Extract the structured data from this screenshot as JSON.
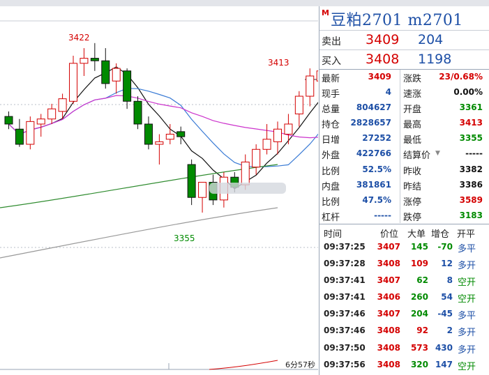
{
  "header": {
    "marker": "M",
    "title": "豆粕2701  m2701"
  },
  "quote": {
    "sell": {
      "label": "卖出",
      "price": "3409",
      "volume": "204"
    },
    "buy": {
      "label": "买入",
      "price": "3408",
      "volume": "1198"
    }
  },
  "stats": [
    {
      "l1": "最新",
      "v1": "3409",
      "c1": "red",
      "l2": "涨跌",
      "v2": "23/0.68%",
      "c2": "red"
    },
    {
      "l1": "现手",
      "v1": "4",
      "c1": "blue",
      "l2": "速涨",
      "v2": "0.00%",
      "c2": "black"
    },
    {
      "l1": "总量",
      "v1": "804627",
      "c1": "blue",
      "l2": "开盘",
      "v2": "3361",
      "c2": "green"
    },
    {
      "l1": "持仓",
      "v1": "2828657",
      "c1": "blue",
      "l2": "最高",
      "v2": "3413",
      "c2": "red"
    },
    {
      "l1": "日增",
      "v1": "27252",
      "c1": "blue",
      "l2": "最低",
      "v2": "3355",
      "c2": "green"
    },
    {
      "l1": "外盘",
      "v1": "422766",
      "c1": "blue",
      "l2": "结算价",
      "v2": "-----",
      "c2": "black"
    },
    {
      "l1": "比例",
      "v1": "52.5%",
      "c1": "blue",
      "l2": "昨收",
      "v2": "3382",
      "c2": "black"
    },
    {
      "l1": "内盘",
      "v1": "381861",
      "c1": "blue",
      "l2": "昨结",
      "v2": "3386",
      "c2": "black"
    },
    {
      "l1": "比例",
      "v1": "47.5%",
      "c1": "blue",
      "l2": "涨停",
      "v2": "3589",
      "c2": "red"
    },
    {
      "l1": "杠杆",
      "v1": "-----",
      "c1": "blue",
      "l2": "跌停",
      "v2": "3183",
      "c2": "green"
    }
  ],
  "trades_header": [
    "时间",
    "价位",
    "大单",
    "增仓",
    "开平"
  ],
  "trades": [
    {
      "time": "09:37:25",
      "price": "3407",
      "vol": "145",
      "chg": "-70",
      "dir": "多平",
      "pc": "red",
      "vc": "green",
      "cc": "green",
      "dc": "blue"
    },
    {
      "time": "09:37:28",
      "price": "3408",
      "vol": "109",
      "chg": "12",
      "dir": "多开",
      "pc": "red",
      "vc": "red",
      "cc": "blue",
      "dc": "blue"
    },
    {
      "time": "09:37:41",
      "price": "3407",
      "vol": "62",
      "chg": "8",
      "dir": "空开",
      "pc": "red",
      "vc": "green",
      "cc": "blue",
      "dc": "green"
    },
    {
      "time": "09:37:41",
      "price": "3406",
      "vol": "260",
      "chg": "54",
      "dir": "空开",
      "pc": "red",
      "vc": "green",
      "cc": "blue",
      "dc": "green"
    },
    {
      "time": "09:37:46",
      "price": "3407",
      "vol": "204",
      "chg": "-45",
      "dir": "多平",
      "pc": "red",
      "vc": "green",
      "cc": "blue",
      "dc": "blue"
    },
    {
      "time": "09:37:46",
      "price": "3408",
      "vol": "92",
      "chg": "2",
      "dir": "多开",
      "pc": "red",
      "vc": "red",
      "cc": "blue",
      "dc": "blue"
    },
    {
      "time": "09:37:50",
      "price": "3408",
      "vol": "573",
      "chg": "430",
      "dir": "多开",
      "pc": "red",
      "vc": "red",
      "cc": "blue",
      "dc": "blue"
    },
    {
      "time": "09:37:56",
      "price": "3408",
      "vol": "320",
      "chg": "147",
      "dir": "空开",
      "pc": "red",
      "vc": "green",
      "cc": "blue",
      "dc": "green"
    }
  ],
  "chart": {
    "high_label": "3422",
    "low_label": "3355",
    "last_high_label": "3413",
    "countdown": "6分57秒",
    "up_color": "#d40000",
    "down_color": "#008a00",
    "candles": [
      {
        "o": 3393,
        "h": 3395,
        "l": 3388,
        "c": 3390
      },
      {
        "o": 3388,
        "h": 3392,
        "l": 3381,
        "c": 3382
      },
      {
        "o": 3382,
        "h": 3393,
        "l": 3380,
        "c": 3391
      },
      {
        "o": 3390,
        "h": 3394,
        "l": 3385,
        "c": 3392
      },
      {
        "o": 3392,
        "h": 3398,
        "l": 3390,
        "c": 3396
      },
      {
        "o": 3395,
        "h": 3402,
        "l": 3392,
        "c": 3400
      },
      {
        "o": 3399,
        "h": 3417,
        "l": 3398,
        "c": 3414
      },
      {
        "o": 3414,
        "h": 3420,
        "l": 3409,
        "c": 3416
      },
      {
        "o": 3416,
        "h": 3422,
        "l": 3411,
        "c": 3415
      },
      {
        "o": 3415,
        "h": 3420,
        "l": 3404,
        "c": 3406
      },
      {
        "o": 3407,
        "h": 3414,
        "l": 3402,
        "c": 3412
      },
      {
        "o": 3411,
        "h": 3412,
        "l": 3396,
        "c": 3399
      },
      {
        "o": 3399,
        "h": 3401,
        "l": 3388,
        "c": 3390
      },
      {
        "o": 3390,
        "h": 3393,
        "l": 3380,
        "c": 3382
      },
      {
        "o": 3382,
        "h": 3386,
        "l": 3374,
        "c": 3383
      },
      {
        "o": 3384,
        "h": 3390,
        "l": 3382,
        "c": 3386
      },
      {
        "o": 3387,
        "h": 3389,
        "l": 3382,
        "c": 3385
      },
      {
        "o": 3374,
        "h": 3376,
        "l": 3358,
        "c": 3361
      },
      {
        "o": 3361,
        "h": 3365,
        "l": 3355,
        "c": 3367
      },
      {
        "o": 3367,
        "h": 3370,
        "l": 3358,
        "c": 3360
      },
      {
        "o": 3360,
        "h": 3371,
        "l": 3357,
        "c": 3369
      },
      {
        "o": 3369,
        "h": 3371,
        "l": 3363,
        "c": 3365
      },
      {
        "o": 3366,
        "h": 3378,
        "l": 3364,
        "c": 3375
      },
      {
        "o": 3373,
        "h": 3382,
        "l": 3370,
        "c": 3380
      },
      {
        "o": 3380,
        "h": 3390,
        "l": 3378,
        "c": 3384
      },
      {
        "o": 3383,
        "h": 3391,
        "l": 3378,
        "c": 3388
      },
      {
        "o": 3386,
        "h": 3394,
        "l": 3382,
        "c": 3390
      },
      {
        "o": 3394,
        "h": 3403,
        "l": 3389,
        "c": 3401
      },
      {
        "o": 3401,
        "h": 3412,
        "l": 3397,
        "c": 3409
      },
      {
        "o": 3407,
        "h": 3413,
        "l": 3404,
        "c": 3411
      }
    ]
  }
}
